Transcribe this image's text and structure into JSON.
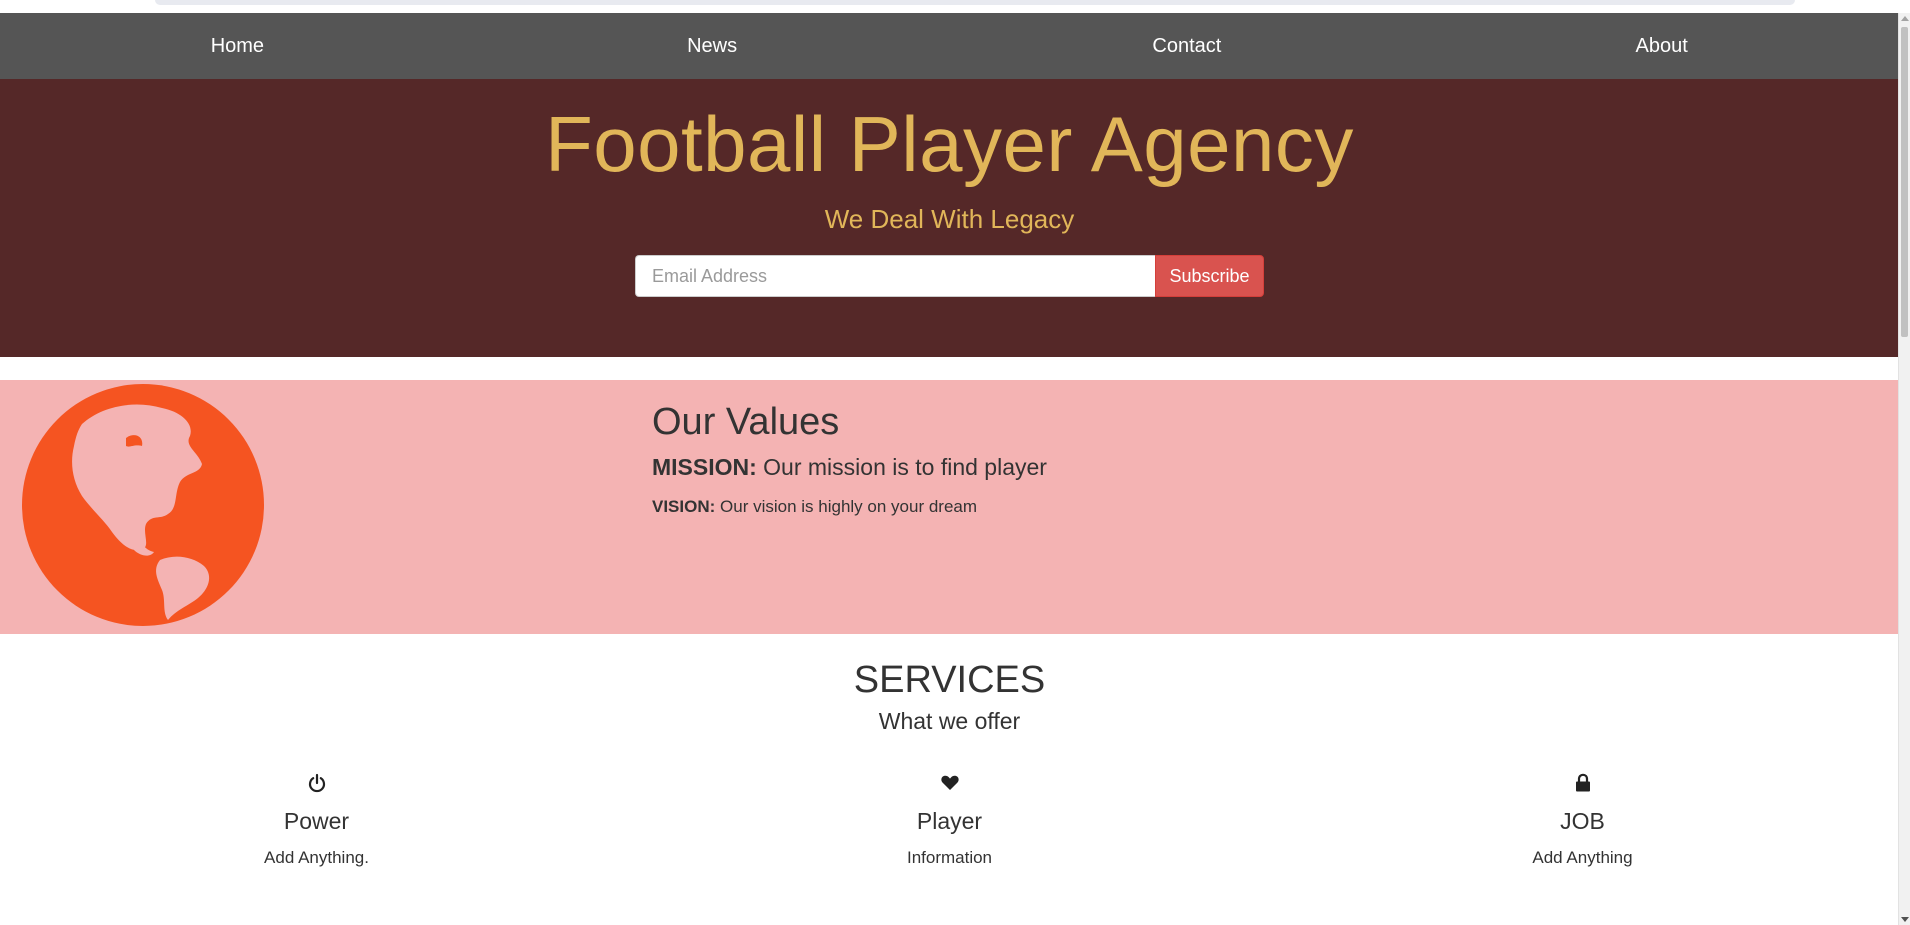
{
  "nav": {
    "items": [
      {
        "label": "Home"
      },
      {
        "label": "News"
      },
      {
        "label": "Contact"
      },
      {
        "label": "About"
      }
    ]
  },
  "hero": {
    "title": "Football Player Agency",
    "subtitle": "We Deal With Legacy",
    "email_placeholder": "Email Address",
    "email_value": "",
    "subscribe_label": "Subscribe"
  },
  "values": {
    "title": "Our Values",
    "mission_label": "MISSION:",
    "mission_text": " Our mission is to find player",
    "vision_label": "VISION:",
    "vision_text": " Our vision is highly on your dream",
    "globe_icon": "globe-americas-icon"
  },
  "services": {
    "title": "SERVICES",
    "subtitle": "What we offer",
    "items": [
      {
        "icon": "power-icon",
        "name": "Power",
        "description": "Add Anything."
      },
      {
        "icon": "heart-icon",
        "name": "Player",
        "description": "Information"
      },
      {
        "icon": "lock-icon",
        "name": "JOB",
        "description": "Add Anything"
      }
    ]
  },
  "colors": {
    "navbar": "#555555",
    "hero_background": "#552828",
    "hero_text": "#e1b659",
    "values_background": "#f4b3b3",
    "globe": "#f55421",
    "subscribe_button": "#d9534f"
  }
}
